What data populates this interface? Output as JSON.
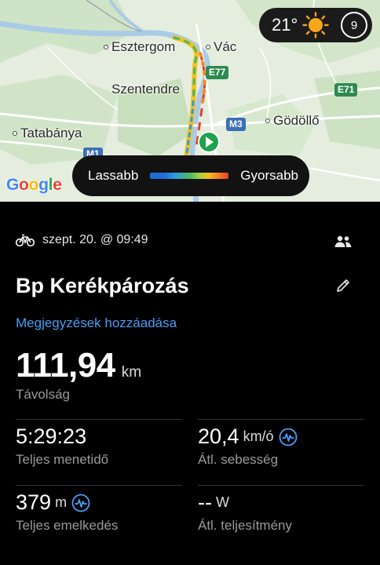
{
  "map": {
    "cities": [
      "Esztergom",
      "Vác",
      "Szentendre",
      "Gödöllő",
      "Tatabánya"
    ],
    "roads": [
      "E77",
      "E71",
      "M3",
      "M1"
    ],
    "attribution": "Google",
    "start_marker_icon": "play-icon",
    "weather": {
      "temperature": "21°",
      "icon": "sun-icon",
      "aqi": "9"
    },
    "speed_legend": {
      "slow_label": "Lassabb",
      "fast_label": "Gyorsabb"
    }
  },
  "activity": {
    "type_icon": "bicycle-icon",
    "date": "szept. 20. @ 09:49",
    "title": "Bp Kerékpározás",
    "add_notes": "Megjegyzések hozzáadása",
    "distance": {
      "value": "111,94",
      "unit": "km",
      "label": "Távolság"
    },
    "stats": {
      "total_time": {
        "value": "5:29:23",
        "label": "Teljes menetidő"
      },
      "avg_speed": {
        "value": "20,4",
        "unit": "km/ó",
        "label": "Átl. sebesség"
      },
      "elevation": {
        "value": "379",
        "unit": "m",
        "label": "Teljes emelkedés"
      },
      "avg_power": {
        "value": "--",
        "unit": "W",
        "label": "Átl. teljesítmény"
      }
    }
  },
  "colors": {
    "link": "#4b9df5",
    "route_slow": "#1f6ed6",
    "route_fast": "#e5402a",
    "start_marker": "#1fa24a"
  }
}
